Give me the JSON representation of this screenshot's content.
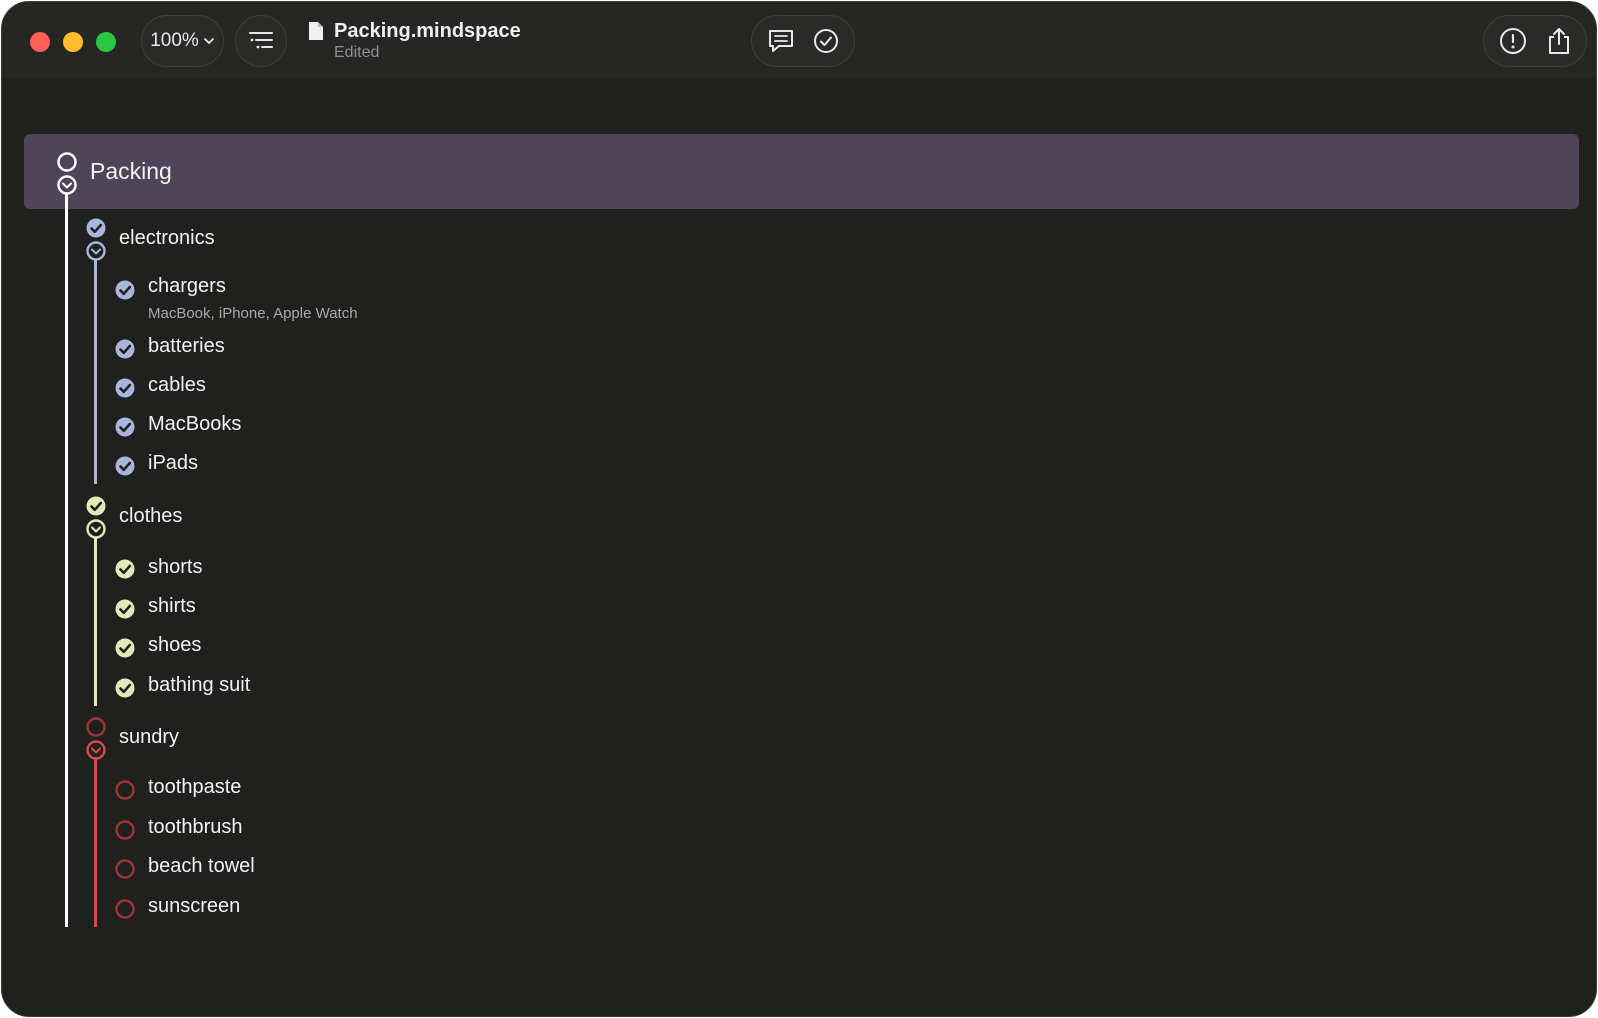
{
  "window": {
    "zoom": "100%",
    "document_title": "Packing.mindspace",
    "document_status": "Edited"
  },
  "toolbar": {
    "icons": [
      "outline-icon",
      "comment-icon",
      "checkmark-circle-icon",
      "info-icon",
      "share-icon"
    ]
  },
  "colors": {
    "background": "#20211e",
    "root_highlight": "#4f4558",
    "electronics": "#a9b5dc",
    "clothes": "#e4e8b8",
    "sundry": "#d84848"
  },
  "outline": {
    "root": {
      "label": "Packing",
      "status": "incomplete"
    },
    "groups": [
      {
        "label": "electronics",
        "status": "complete",
        "items": [
          {
            "label": "chargers",
            "note": "MacBook, iPhone, Apple Watch",
            "checked": true
          },
          {
            "label": "batteries",
            "checked": true
          },
          {
            "label": "cables",
            "checked": true
          },
          {
            "label": "MacBooks",
            "checked": true
          },
          {
            "label": "iPads",
            "checked": true
          }
        ]
      },
      {
        "label": "clothes",
        "status": "complete",
        "items": [
          {
            "label": "shorts",
            "checked": true
          },
          {
            "label": "shirts",
            "checked": true
          },
          {
            "label": "shoes",
            "checked": true
          },
          {
            "label": "bathing suit",
            "checked": true
          }
        ]
      },
      {
        "label": "sundry",
        "status": "incomplete",
        "items": [
          {
            "label": "toothpaste",
            "checked": false
          },
          {
            "label": "toothbrush",
            "checked": false
          },
          {
            "label": "beach towel",
            "checked": false
          },
          {
            "label": "sunscreen",
            "checked": false
          }
        ]
      }
    ]
  }
}
